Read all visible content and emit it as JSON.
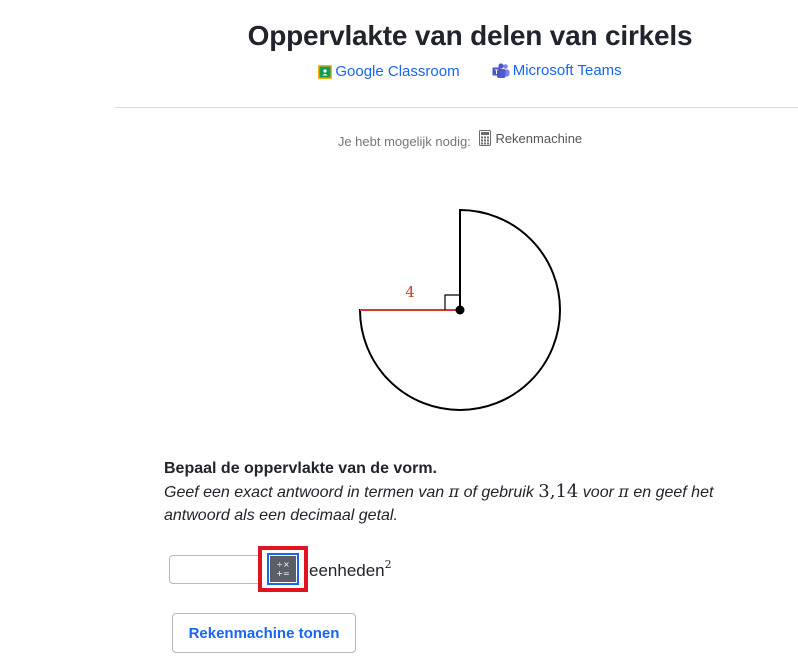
{
  "header": {
    "title": "Oppervlakte van delen van cirkels",
    "share": {
      "google_classroom": "Google Classroom",
      "microsoft_teams": "Microsoft Teams"
    }
  },
  "tools_needed": {
    "label": "Je hebt mogelijk nodig:",
    "tool": "Rekenmachine",
    "tool_icon": "calculator-icon"
  },
  "figure": {
    "radius_label": "4",
    "radius_color": "#cf3c2b",
    "right_angle_marker": true
  },
  "question": {
    "prompt": "Bepaal de oppervlakte van de vorm.",
    "instruction_part1": "Geef een exact antwoord in termen van ",
    "pi_symbol": "π",
    "instruction_part2": " of gebruik ",
    "pi_approx": "3,14",
    "instruction_part3": " voor ",
    "instruction_part4": " en geef het antwoord als een decimaal getal."
  },
  "answer": {
    "value": "",
    "placeholder": "",
    "units_label": "eenheden",
    "units_exponent": "2",
    "calc_keypad_symbols_top": "÷×",
    "calc_keypad_symbols_bottom": "+="
  },
  "buttons": {
    "show_calculator": "Rekenmachine tonen"
  },
  "colors": {
    "link": "#1865f2",
    "highlight": "#e0141e",
    "google_green": "#0f9d58",
    "teams_purple": "#5059c9"
  }
}
